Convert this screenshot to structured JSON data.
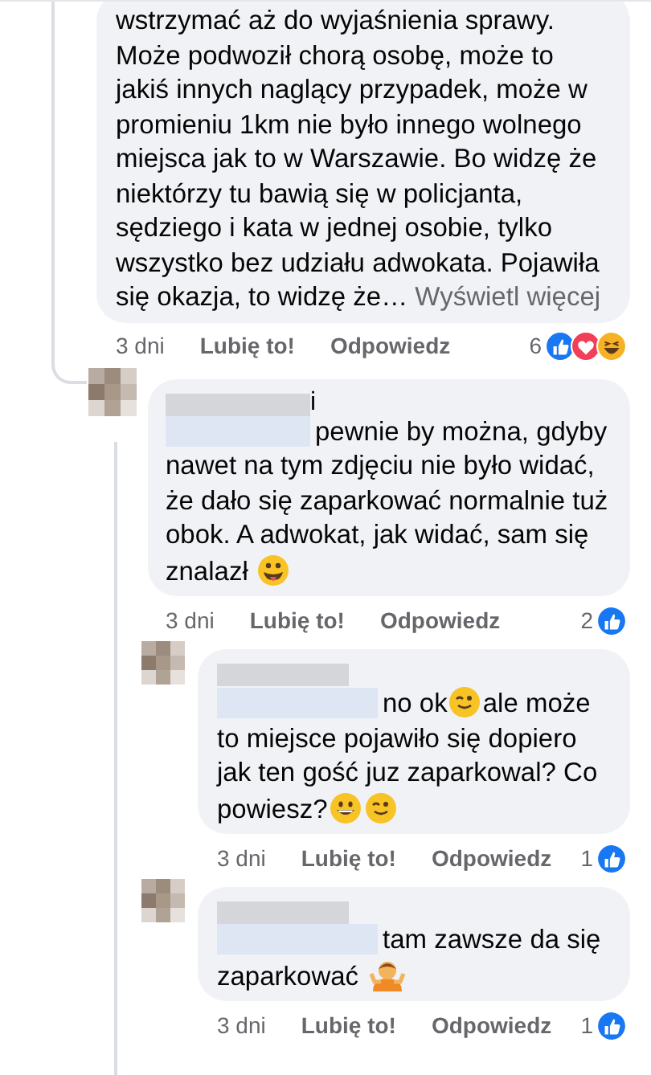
{
  "comments": [
    {
      "text": [
        {
          "kind": "text",
          "text": "wstrzymać aż do wyjaśnienia sprawy. Może podwoził chorą osobę, może to jakiś innych naglący przypadek, może w promieniu 1km nie było innego wolnego miejsca jak to w Warszawie. Bo widzę że niektórzy tu bawią się w policjanta, sędziego i kata w jednej osobie, tylko wszystko bez udziału adwokata. Pojawiła się okazja, to widzę że…"
        }
      ],
      "see_more": "Wyświetl więcej",
      "time": "3 dni",
      "like_action": "Lubię to!",
      "reply_action": "Odpowiedz",
      "reaction_count": "6",
      "reactions": [
        {
          "kind": "like"
        },
        {
          "kind": "love"
        },
        {
          "kind": "haha"
        }
      ],
      "children": [
        {
          "author_tail": "i",
          "text": [
            {
              "kind": "mention"
            },
            {
              "kind": "text",
              "text": "pewnie by można, gdyby nawet na tym zdjęciu nie było widać, że dało się zaparkować normalnie tuż obok. A adwokat, jak widać, sam się znalazł "
            },
            {
              "kind": "tongue_emoji"
            }
          ],
          "time": "3 dni",
          "like_action": "Lubię to!",
          "reply_action": "Odpowiedz",
          "reaction_count": "2",
          "reactions": [
            {
              "kind": "like"
            }
          ],
          "children": [
            {
              "text": [
                {
                  "kind": "mention"
                },
                {
                  "kind": "text",
                  "text": "no ok"
                },
                {
                  "kind": "wink_emoji"
                },
                {
                  "kind": "text",
                  "text": "ale może to miejsce pojawiło się dopiero jak ten gość juz zaparkowal? Co powiesz?"
                },
                {
                  "kind": "smile_emoji"
                },
                {
                  "kind": "wink_emoji"
                }
              ],
              "time": "3 dni",
              "like_action": "Lubię to!",
              "reply_action": "Odpowiedz",
              "reaction_count": "1",
              "reactions": [
                {
                  "kind": "like"
                }
              ]
            },
            {
              "text": [
                {
                  "kind": "mention"
                },
                {
                  "kind": "text",
                  "text": "tam zawsze da się zaparkować "
                },
                {
                  "kind": "shrug_emoji"
                }
              ],
              "time": "3 dni",
              "like_action": "Lubię to!",
              "reply_action": "Odpowiedz",
              "reaction_count": "1",
              "reactions": [
                {
                  "kind": "like"
                }
              ]
            }
          ]
        }
      ]
    }
  ]
}
